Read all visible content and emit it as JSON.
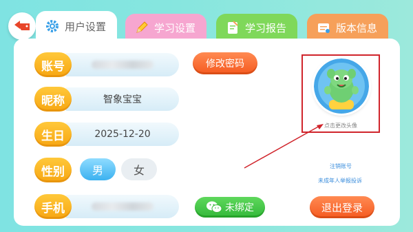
{
  "tabs": [
    {
      "label": "用户设置",
      "icon": "gear-icon",
      "active": true
    },
    {
      "label": "学习设置",
      "icon": "pencil-icon",
      "active": false
    },
    {
      "label": "学习报告",
      "icon": "report-icon",
      "active": false
    },
    {
      "label": "版本信息",
      "icon": "version-icon",
      "active": false
    }
  ],
  "rows": {
    "account": {
      "label": "账号"
    },
    "nickname": {
      "label": "昵称",
      "value": "智象宝宝"
    },
    "birthday": {
      "label": "生日",
      "value": "2025-12-20"
    },
    "gender": {
      "label": "性别",
      "male": "男",
      "female": "女",
      "selected": "男"
    },
    "phone": {
      "label": "手机"
    }
  },
  "buttons": {
    "change_password": "修改密码",
    "wechat_bind": "未绑定",
    "logout": "退出登录"
  },
  "avatar": {
    "hint": "点击更改头像"
  },
  "links": {
    "cancel_account": "注销账号",
    "minor_report": "未成年人举报投诉"
  },
  "colors": {
    "background": "#86e6df",
    "label_orange": "#f7a612",
    "button_orange": "#f55a20",
    "button_green": "#33b83a",
    "highlight_red": "#d0242b"
  }
}
